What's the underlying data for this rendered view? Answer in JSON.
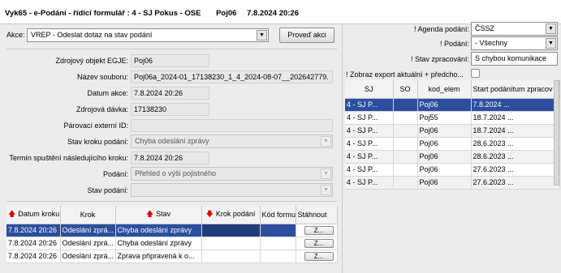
{
  "window": {
    "title": "Vyk65 - e-Podání - řídící formulář : 4 - SJ Pokus - OSE",
    "user": "Poj06",
    "datetime": "7.8.2024 20:26"
  },
  "action": {
    "label": "Akce:",
    "selected": "VREP - Odeslat dotaz na stav podání",
    "button": "Proveď akci"
  },
  "detail": {
    "fields": [
      {
        "label": "Zdrojový objekt EGJE:",
        "value": "Poj06"
      },
      {
        "label": "Název souboru:",
        "value": "Poj06a_2024-01_17138230_1_4_2024-08-07__202642779."
      },
      {
        "label": "Datum akce:",
        "value": "7.8.2024 20:26"
      },
      {
        "label": "Zdrojová dávka:",
        "value": "17138230"
      },
      {
        "label": "Párovací externí ID:",
        "value": ""
      },
      {
        "label": "Stav kroku podání:",
        "value": "Chyba odeslání zprávy"
      },
      {
        "label": "Termín spuštění následujícího kroku:",
        "value": "7.8.2024 20:26"
      },
      {
        "label": "Podání:",
        "value": "Přehled o výši pojistného"
      },
      {
        "label": "Stav podání:",
        "value": ""
      }
    ]
  },
  "history": {
    "columns": [
      "Datum kroku",
      "Krok",
      "Stav",
      "Krok podání",
      "Kód formulá",
      "Stáhnout"
    ],
    "download_label": "Z...",
    "rows": [
      {
        "date": "7.8.2024 20:26",
        "step": "Odeslání zprá...",
        "state": "Chyba odeslání zprávy",
        "krok": "",
        "kod": ""
      },
      {
        "date": "7.8.2024 20:26",
        "step": "Odeslání zprá...",
        "state": "Chyba odeslání zprávy",
        "krok": "",
        "kod": ""
      },
      {
        "date": "7.8.2024 20:26",
        "step": "Odeslání zprá...",
        "state": "Zprava připravená k o...",
        "krok": "",
        "kod": ""
      }
    ]
  },
  "filters": {
    "agenda_label": "! Agenda podání:",
    "agenda_value": "ČSSZ",
    "podani_label": "! Podání:",
    "podani_value": "- Všechny",
    "stav_label": "! Stav zpracování:",
    "stav_value": "S chybou komunikace",
    "export_label": "! Zobraz export aktuální + předcho..."
  },
  "list": {
    "columns": [
      "SJ",
      "SO",
      "kod_elem",
      "Start podánítum zpracov"
    ],
    "rows": [
      {
        "sj": "4 - SJ P...",
        "so": "",
        "kod": "Poj06",
        "start": "7.8.2024 ..."
      },
      {
        "sj": "4 - SJ P...",
        "so": "",
        "kod": "Poj55",
        "start": "18.7.2024 ..."
      },
      {
        "sj": "4 - SJ P...",
        "so": "",
        "kod": "Poj06",
        "start": "18.7.2024 ..."
      },
      {
        "sj": "4 - SJ P...",
        "so": "",
        "kod": "Poj06",
        "start": "28.6.2023 ..."
      },
      {
        "sj": "4 - SJ P...",
        "so": "",
        "kod": "Poj06",
        "start": "28.6.2023 ..."
      },
      {
        "sj": "4 - SJ P...",
        "so": "",
        "kod": "Poj06",
        "start": "27.6.2023 ..."
      },
      {
        "sj": "4 - SJ P...",
        "so": "",
        "kod": "Poj06",
        "start": "27.6.2023 ..."
      }
    ]
  }
}
